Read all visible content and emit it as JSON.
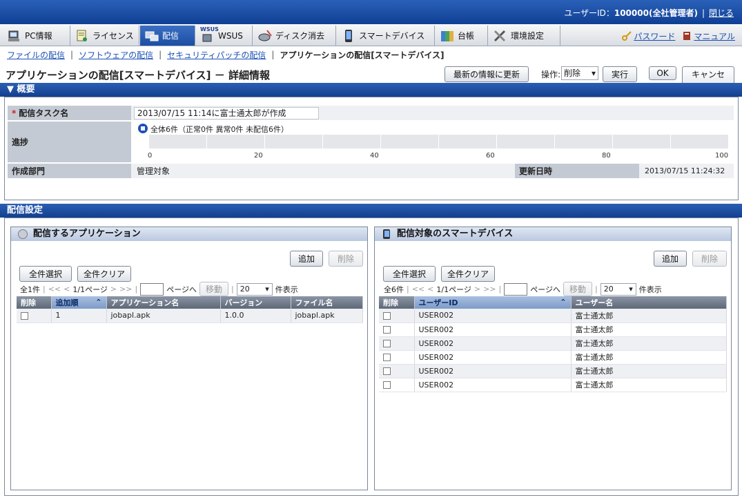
{
  "header": {
    "user_label": "ユーザーID：",
    "user_value": "100000(全社管理者)",
    "logout": "閉じる"
  },
  "menu": {
    "items": [
      {
        "label": "PC情報",
        "icon": "pc-icon"
      },
      {
        "label": "ライセンス",
        "icon": "license-icon"
      },
      {
        "label": "配信",
        "icon": "distribution-icon",
        "active": true
      },
      {
        "label": "WSUS",
        "icon": "wsus-icon",
        "badge": "WSUS"
      },
      {
        "label": "ディスク消去",
        "icon": "disk-erase-icon"
      },
      {
        "label": "スマートデバイス",
        "icon": "smart-device-icon"
      },
      {
        "label": "台帳",
        "icon": "ledger-icon"
      },
      {
        "label": "環境設定",
        "icon": "settings-icon"
      }
    ],
    "password": "パスワード",
    "manual": "マニュアル"
  },
  "subnav": {
    "items": [
      "ファイルの配信",
      "ソフトウェアの配信",
      "セキュリティパッチの配信"
    ],
    "current": "アプリケーションの配信[スマートデバイス]"
  },
  "title": "アプリケーションの配信[スマートデバイス] － 詳細情報",
  "toolbar": {
    "refresh": "最新の情報に更新",
    "operation_label": "操作:",
    "operation_value": "削除",
    "execute": "実行",
    "ok": "OK",
    "cancel": "キャンセル"
  },
  "overview": {
    "header": "▼ 概要",
    "task_label": "配信タスク名",
    "required_mark": "*",
    "task_value": "2013/07/15 11:14に富士通太郎が作成",
    "progress_label": "進捗",
    "progress_text": "全体6件（正常0件 異常0件 未配信6件）",
    "progress_percent": 0,
    "ticks": [
      "0",
      "20",
      "40",
      "60",
      "80",
      "100"
    ],
    "dept_label": "作成部門",
    "dept_value": "管理対象",
    "updated_label": "更新日時",
    "updated_value": "2013/07/15 11:24:32"
  },
  "settings_header": "配信設定",
  "apps_panel": {
    "title": "配信するアプリケーション",
    "add": "追加",
    "delete": "削除",
    "select_all": "全件選択",
    "clear_all": "全件クリア",
    "count": "全1件",
    "first": "<<",
    "prev": "<",
    "page": "1/1ページ",
    "next": ">",
    "last": ">>",
    "goto_suffix": "ページへ",
    "move": "移動",
    "per_page": "20",
    "per_page_suffix": "件表示",
    "columns": [
      "削除",
      "追加順",
      "アプリケーション名",
      "バージョン",
      "ファイル名"
    ],
    "rows": [
      {
        "order": "1",
        "name": "jobapl.apk",
        "version": "1.0.0",
        "file": "jobapl.apk"
      }
    ]
  },
  "devices_panel": {
    "title": "配信対象のスマートデバイス",
    "add": "追加",
    "delete": "削除",
    "select_all": "全件選択",
    "clear_all": "全件クリア",
    "count": "全6件",
    "first": "<<",
    "prev": "<",
    "page": "1/1ページ",
    "next": ">",
    "last": ">>",
    "goto_suffix": "ページへ",
    "move": "移動",
    "per_page": "20",
    "per_page_suffix": "件表示",
    "columns": [
      "削除",
      "ユーザーID",
      "ユーザー名"
    ],
    "rows": [
      {
        "user_id": "USER002",
        "user_name": "富士通太郎"
      },
      {
        "user_id": "USER002",
        "user_name": "富士通太郎"
      },
      {
        "user_id": "USER002",
        "user_name": "富士通太郎"
      },
      {
        "user_id": "USER002",
        "user_name": "富士通太郎"
      },
      {
        "user_id": "USER002",
        "user_name": "富士通太郎"
      },
      {
        "user_id": "USER002",
        "user_name": "富士通太郎"
      }
    ]
  }
}
